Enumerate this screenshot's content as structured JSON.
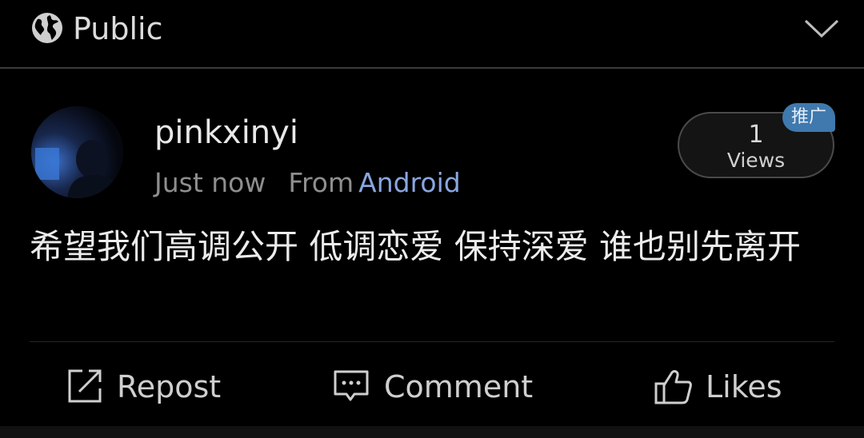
{
  "header": {
    "visibility_label": "Public",
    "icons": {
      "visibility": "globe-icon",
      "collapse": "chevron-down-icon"
    }
  },
  "post": {
    "author": "pinkxinyi",
    "time": "Just now",
    "from_label": "From",
    "source": "Android",
    "text": "希望我们高调公开 低调恋爱 保持深爱 谁也别先离开",
    "views": {
      "count": "1",
      "label": "Views"
    },
    "promo_badge": "推广"
  },
  "actions": {
    "repost": "Repost",
    "comment": "Comment",
    "likes": "Likes"
  },
  "colors": {
    "background": "#000000",
    "link_accent": "#8aa6e0",
    "badge": "#3f79ad"
  }
}
